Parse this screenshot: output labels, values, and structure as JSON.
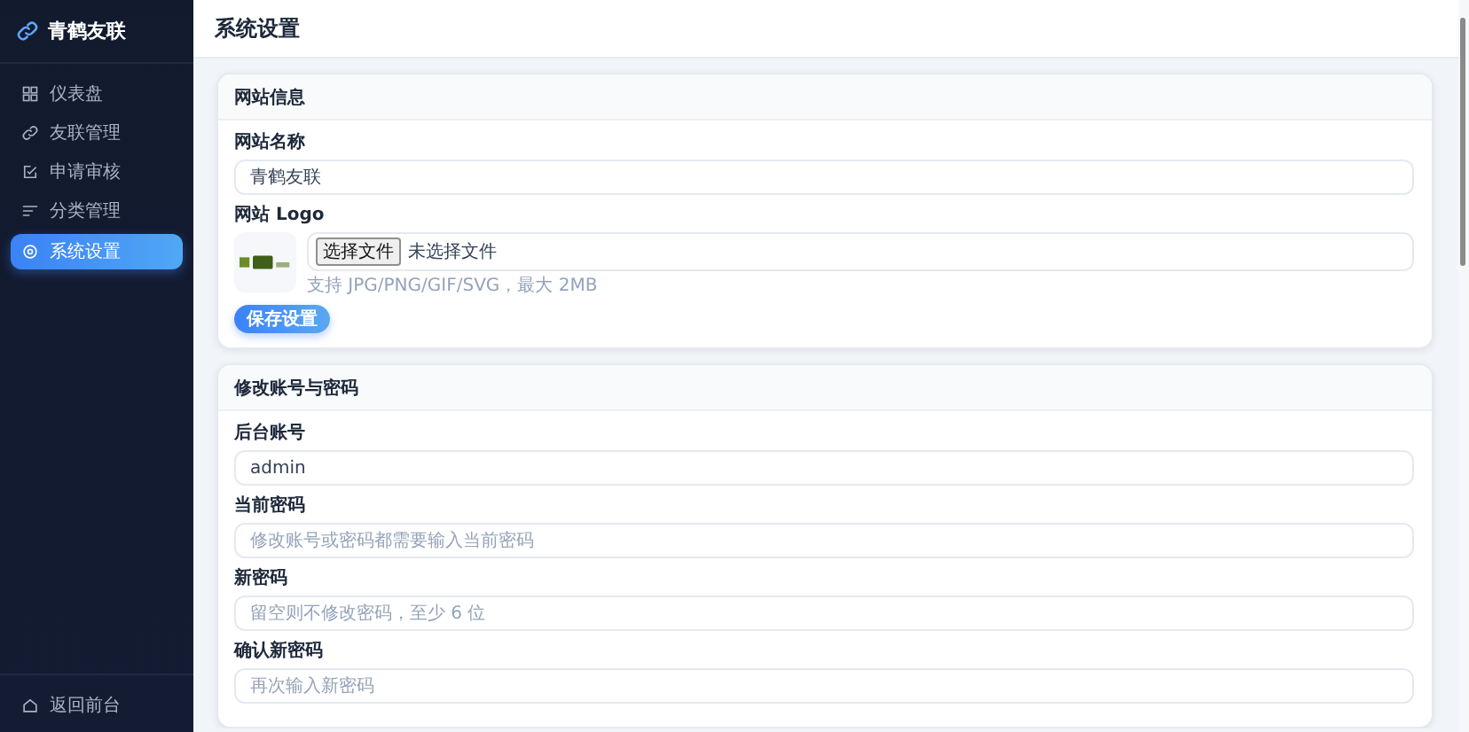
{
  "sidebar": {
    "brand": "青鹤友联",
    "items": [
      {
        "label": "仪表盘",
        "selected": false
      },
      {
        "label": "友联管理",
        "selected": false
      },
      {
        "label": "申请审核",
        "selected": false
      },
      {
        "label": "分类管理",
        "selected": false
      },
      {
        "label": "系统设置",
        "selected": true
      }
    ],
    "footer": {
      "label": "返回前台"
    }
  },
  "header": {
    "title": "系统设置"
  },
  "site_card": {
    "title": "网站信息",
    "name_field": {
      "label": "网站名称",
      "value": "青鹤友联"
    },
    "logo_field": {
      "label": "网站 Logo",
      "choose_button": "选择文件",
      "file_status": "未选择文件",
      "hint": "支持 JPG/PNG/GIF/SVG，最大 2MB"
    },
    "save_button": "保存设置"
  },
  "account_card": {
    "title": "修改账号与密码",
    "fields": [
      {
        "label": "后台账号",
        "value": "admin"
      },
      {
        "label": "当前密码",
        "placeholder": "修改账号或密码都需要输入当前密码"
      },
      {
        "label": "新密码",
        "placeholder": "留空则不修改密码，至少 6 位"
      },
      {
        "label": "确认新密码",
        "placeholder": "再次输入新密码"
      }
    ]
  }
}
